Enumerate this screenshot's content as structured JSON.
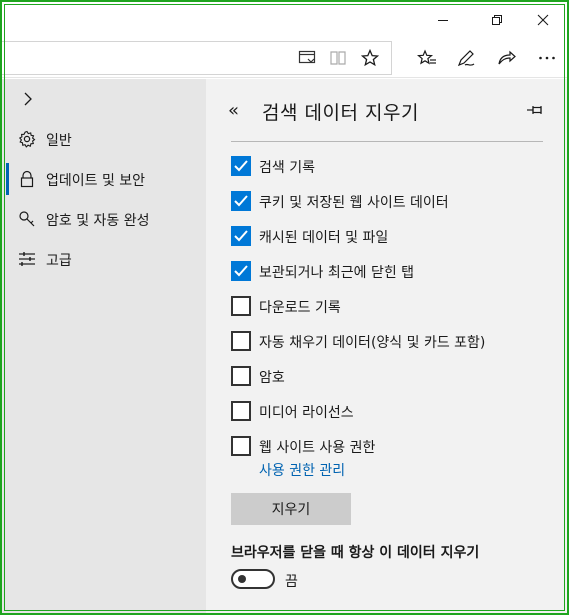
{
  "window": {
    "minimize_icon": "minimize-icon",
    "restore_icon": "restore-icon",
    "close_icon": "close-icon"
  },
  "toolbar": {
    "address_value": "",
    "icons": [
      "reading-list-icon",
      "reading-view-icon",
      "favorite-star-icon",
      "favorites-hub-icon",
      "pen-icon",
      "share-icon",
      "more-icon"
    ]
  },
  "sidebar": {
    "items": [
      {
        "label": "일반",
        "icon": "gear-icon"
      },
      {
        "label": "업데이트 및 보안",
        "icon": "lock-icon",
        "active": true
      },
      {
        "label": "암호 및 자동 완성",
        "icon": "key-icon"
      },
      {
        "label": "고급",
        "icon": "sliders-icon"
      }
    ]
  },
  "panel": {
    "back_label": "«",
    "title": "검색 데이터 지우기",
    "options": [
      {
        "label": "검색 기록",
        "checked": true
      },
      {
        "label": "쿠키 및 저장된 웹 사이트 데이터",
        "checked": true
      },
      {
        "label": "캐시된 데이터 및 파일",
        "checked": true
      },
      {
        "label": "보관되거나 최근에 닫힌 탭",
        "checked": true
      },
      {
        "label": "다운로드 기록",
        "checked": false
      },
      {
        "label": "자동 채우기 데이터(양식 및 카드 포함)",
        "checked": false
      },
      {
        "label": "암호",
        "checked": false
      },
      {
        "label": "미디어 라이선스",
        "checked": false
      },
      {
        "label": "웹 사이트 사용 권한",
        "checked": false
      }
    ],
    "manage_link": "사용 권한 관리",
    "clear_button": "지우기",
    "always_clear_label": "브라우저를 닫을 때 항상 이 데이터 지우기",
    "toggle_state": "끔"
  },
  "colors": {
    "accent": "#0078d7",
    "link": "#0063b1",
    "frame": "#1fa51f",
    "panel_bg": "#f2f2f2",
    "nav_bg": "#e6e6e6"
  }
}
